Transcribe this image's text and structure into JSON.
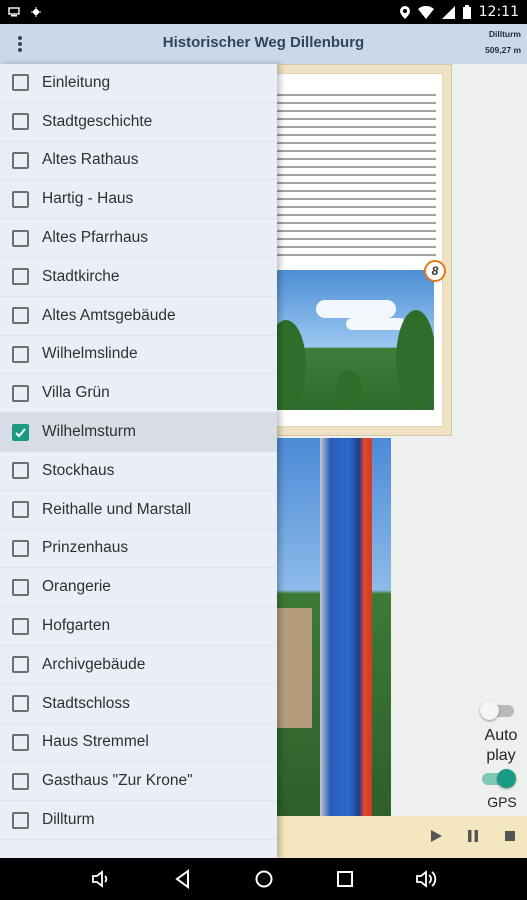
{
  "status_bar": {
    "time": "12:11"
  },
  "app_bar": {
    "title": "Historischer Weg Dillenburg",
    "distance_target": "Dillturm",
    "distance_value": "509,27 m"
  },
  "drawer": {
    "items": [
      {
        "label": "Einleitung",
        "checked": false
      },
      {
        "label": "Stadtgeschichte",
        "checked": false
      },
      {
        "label": "Altes Rathaus",
        "checked": false
      },
      {
        "label": "Hartig - Haus",
        "checked": false
      },
      {
        "label": "Altes Pfarrhaus",
        "checked": false
      },
      {
        "label": "Stadtkirche",
        "checked": false
      },
      {
        "label": "Altes Amtsgebäude",
        "checked": false
      },
      {
        "label": "Wilhelmslinde",
        "checked": false
      },
      {
        "label": "Villa Grün",
        "checked": false
      },
      {
        "label": "Wilhelmsturm",
        "checked": true
      },
      {
        "label": "Stockhaus",
        "checked": false
      },
      {
        "label": "Reithalle und Marstall",
        "checked": false
      },
      {
        "label": "Prinzenhaus",
        "checked": false
      },
      {
        "label": "Orangerie",
        "checked": false
      },
      {
        "label": "Hofgarten",
        "checked": false
      },
      {
        "label": "Archivgebäude",
        "checked": false
      },
      {
        "label": "Stadtschloss",
        "checked": false
      },
      {
        "label": "Haus Stremmel",
        "checked": false
      },
      {
        "label": "Gasthaus \"Zur Krone\"",
        "checked": false
      },
      {
        "label": "Dillturm",
        "checked": false
      }
    ]
  },
  "page_card": {
    "page_number": "8"
  },
  "controls": {
    "autoplay_label": "Auto play",
    "autoplay_on": false,
    "gps_label": "GPS",
    "gps_on": true
  },
  "colors": {
    "app_bar": "#c9d9ea",
    "accent": "#1a9a82",
    "drawer": "#eaeff7",
    "bottom_bar": "#f4e6bf"
  },
  "icons": {
    "menu": "more-vert-icon",
    "play": "play-icon",
    "pause": "pause-icon",
    "stop": "stop-icon",
    "chevron": "chevron-up-icon"
  }
}
